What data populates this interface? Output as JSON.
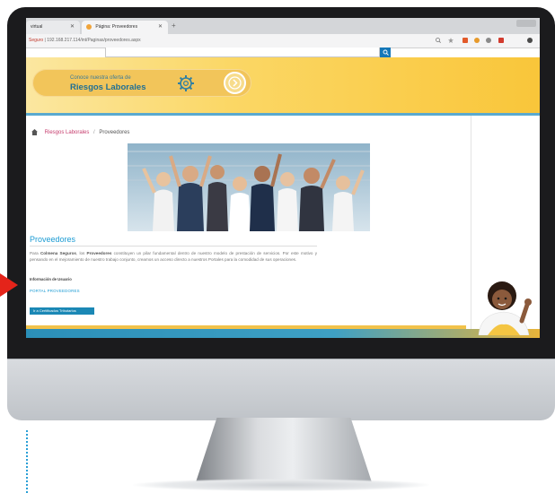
{
  "browser": {
    "tabs": [
      {
        "label": "virtual"
      },
      {
        "label": "Página: Proveedores"
      }
    ],
    "new_tab": "+",
    "address": {
      "security": "Seguro",
      "url": "192.168.217.114/int/Paginas/proveedores.aspx"
    },
    "colors": {
      "toolbar": "#f4f4f5",
      "tabbar": "#d4d6d9"
    }
  },
  "banner": {
    "line1": "Conoce nuestra oferta de",
    "line2": "Riesgos Laborales",
    "colors": {
      "from": "#fbe7a0",
      "to": "#f9c63a",
      "text": "#1f6f95"
    }
  },
  "breadcrumb": {
    "items": [
      "Riesgos Laborales",
      "Proveedores"
    ],
    "separator": "/"
  },
  "section": {
    "title": "Proveedores",
    "body_intro": "Para ",
    "company": "Colmena Seguros",
    "body_mid": ", los ",
    "providers_word": "Proveedores",
    "body_rest": " constituyen un pilar fundamental dentro de nuestro modelo de prestación de servicios. Por este motivo y pensando en el mejoramiento de nuestro trabajo conjunto, creamos un acceso directo a nuestros Portales para la comodidad de sus operaciones.",
    "small_label": "Información de Usuario",
    "portal_link": "PORTAL PROVEEDORES",
    "cert_button": "Ir a Certificados Tributarios"
  },
  "icons": {
    "home": "home-icon",
    "gear": "gear-icon",
    "arrow": "arrow-right-circle-icon",
    "search": "search-icon",
    "star": "star-icon"
  },
  "accent_colors": {
    "link": "#1b9bd3",
    "breadcrumb_link": "#c63c6d",
    "pointer": "#e4241a",
    "button": "#1b88b5"
  }
}
